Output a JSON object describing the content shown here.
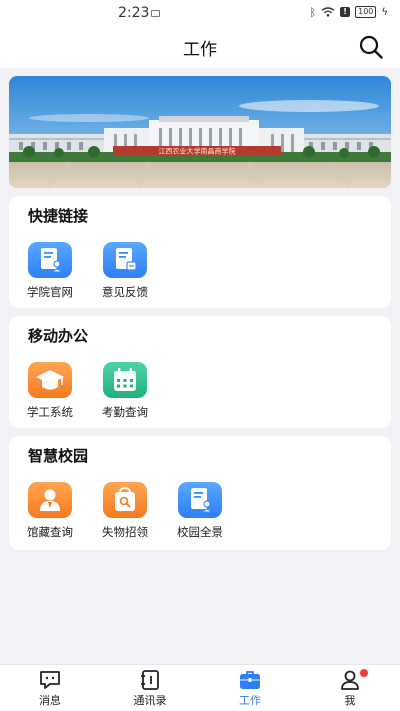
{
  "status_bar": {
    "time": "2:23",
    "battery": "100"
  },
  "header": {
    "title": "工作"
  },
  "banner": {
    "sign_text": "江西农业大学南昌商学院"
  },
  "sections": [
    {
      "title": "快捷链接",
      "items": [
        {
          "label": "学院官网",
          "icon": "document-user-icon",
          "color": "#3b8cf8"
        },
        {
          "label": "意见反馈",
          "icon": "document-edit-icon",
          "color": "#3b8cf8"
        }
      ]
    },
    {
      "title": "移动办公",
      "items": [
        {
          "label": "学工系统",
          "icon": "graduation-cap-icon",
          "color": "#f7872d"
        },
        {
          "label": "考勤查询",
          "icon": "calendar-icon",
          "color": "#2cbd88"
        }
      ]
    },
    {
      "title": "智慧校园",
      "items": [
        {
          "label": "馆藏查询",
          "icon": "person-icon",
          "color": "#f7872d"
        },
        {
          "label": "失物招领",
          "icon": "bag-search-icon",
          "color": "#f7872d"
        },
        {
          "label": "校园全景",
          "icon": "document-user-icon",
          "color": "#3b8cf8"
        }
      ]
    }
  ],
  "bottom_nav": [
    {
      "label": "消息",
      "icon": "chat-icon",
      "active": false
    },
    {
      "label": "通讯录",
      "icon": "contacts-book-icon",
      "active": false
    },
    {
      "label": "工作",
      "icon": "briefcase-icon",
      "active": true
    },
    {
      "label": "我",
      "icon": "user-icon",
      "active": false,
      "badge": true
    }
  ],
  "colors": {
    "accent": "#2f7ef5",
    "badge": "#f03a3a",
    "background": "#f2f2f6"
  }
}
